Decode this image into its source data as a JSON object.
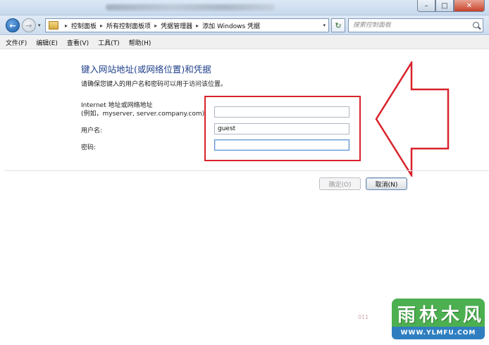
{
  "window": {
    "controls": {
      "minimize": "–",
      "maximize": "□",
      "close": "✕"
    }
  },
  "nav": {
    "back_icon": "back-arrow-icon",
    "forward_icon": "forward-arrow-icon",
    "back_glyph": "←",
    "forward_glyph": "→",
    "dropdown_glyph": "▾",
    "breadcrumb": [
      "控制面板",
      "所有控制面板项",
      "凭据管理器",
      "添加 Windows 凭据"
    ],
    "breadcrumb_separator": "▸",
    "refresh_glyph": "↻",
    "search_placeholder": "搜索控制面板"
  },
  "menubar": {
    "items": [
      "文件(F)",
      "编辑(E)",
      "查看(V)",
      "工具(T)",
      "帮助(H)"
    ]
  },
  "form": {
    "heading": "键入网站地址(或网络位置)和凭据",
    "description": "请确保您键入的用户名和密码可以用于访问该位置。",
    "address_label_line1": "Internet 地址或网络地址",
    "address_label_line2": "(例如，myserver, server.company.com):",
    "address_value": "",
    "username_label": "用户名:",
    "username_value": "guest",
    "password_label": "密码:",
    "password_value": ""
  },
  "buttons": {
    "ok": "确定(O)",
    "cancel": "取消(N)"
  },
  "annotation": {
    "highlight_color": "#d8222a"
  },
  "footer": {
    "faint_text": "011"
  },
  "watermark": {
    "chars": [
      "雨",
      "林",
      "木",
      "风"
    ],
    "url": "WWW.YLMFU.COM"
  }
}
